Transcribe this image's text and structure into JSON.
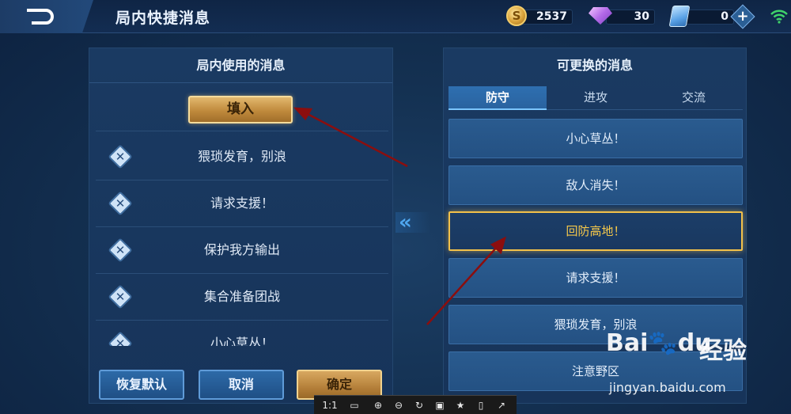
{
  "header": {
    "title": "局内快捷消息",
    "back_icon": "back-arrow-icon",
    "resources": [
      {
        "name": "gold",
        "icon": "gold-coin-icon",
        "value": "2537"
      },
      {
        "name": "diamond",
        "icon": "diamond-icon",
        "value": "30"
      },
      {
        "name": "coupon",
        "icon": "coupon-icon",
        "value": "0"
      }
    ],
    "plus_label": "+",
    "wifi_icon": "wifi-icon"
  },
  "left_panel": {
    "title": "局内使用的消息",
    "fill_button": "填入",
    "items": [
      {
        "label": "猥琐发育，别浪"
      },
      {
        "label": "请求支援！"
      },
      {
        "label": "保护我方输出"
      },
      {
        "label": "集合准备团战"
      },
      {
        "label": "小心草丛！"
      }
    ],
    "buttons": {
      "restore": "恢复默认",
      "cancel": "取消",
      "confirm": "确定"
    }
  },
  "swap_icon": "«",
  "right_panel": {
    "title": "可更换的消息",
    "tabs": [
      {
        "label": "防守",
        "active": true
      },
      {
        "label": "进攻",
        "active": false
      },
      {
        "label": "交流",
        "active": false
      }
    ],
    "items": [
      {
        "label": "小心草丛！",
        "selected": false
      },
      {
        "label": "敌人消失！",
        "selected": false
      },
      {
        "label": "回防高地！",
        "selected": true
      },
      {
        "label": "请求支援！",
        "selected": false
      },
      {
        "label": "猥琐发育，别浪",
        "selected": false
      },
      {
        "label": "注意野区",
        "selected": false
      }
    ]
  },
  "viewer_toolbar": {
    "ratio": "1:1",
    "tools": [
      "fit-icon",
      "zoom-in-icon",
      "zoom-out-icon",
      "rotate-icon",
      "save-icon",
      "bookmark-icon",
      "fullscreen-icon",
      "share-icon"
    ]
  },
  "watermark": {
    "logo": "Bai",
    "logo_du": "du",
    "logo_sub": "经验",
    "url": "jingyan.baidu.com"
  },
  "colors": {
    "accent_gold": "#f2c14a",
    "annotation_red": "#8b0e0e",
    "tab_active": "#2e6fb0"
  }
}
